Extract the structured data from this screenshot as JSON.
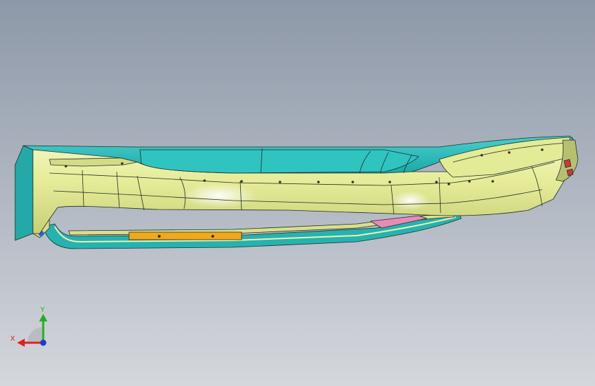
{
  "viewport": {
    "background_top": "#8d98a8",
    "background_bottom": "#d4d7dc"
  },
  "model": {
    "body_color": "#e9efa0",
    "panel_color": "#2bbcbc",
    "strip_color": "#f2a81a",
    "pink_color": "#e88ab8",
    "edge_color": "#1d2a22"
  },
  "triad": {
    "x_label": "X",
    "y_label": "Y",
    "x_color": "#e02020",
    "y_color": "#20b020",
    "z_color": "#1c3ccc"
  }
}
